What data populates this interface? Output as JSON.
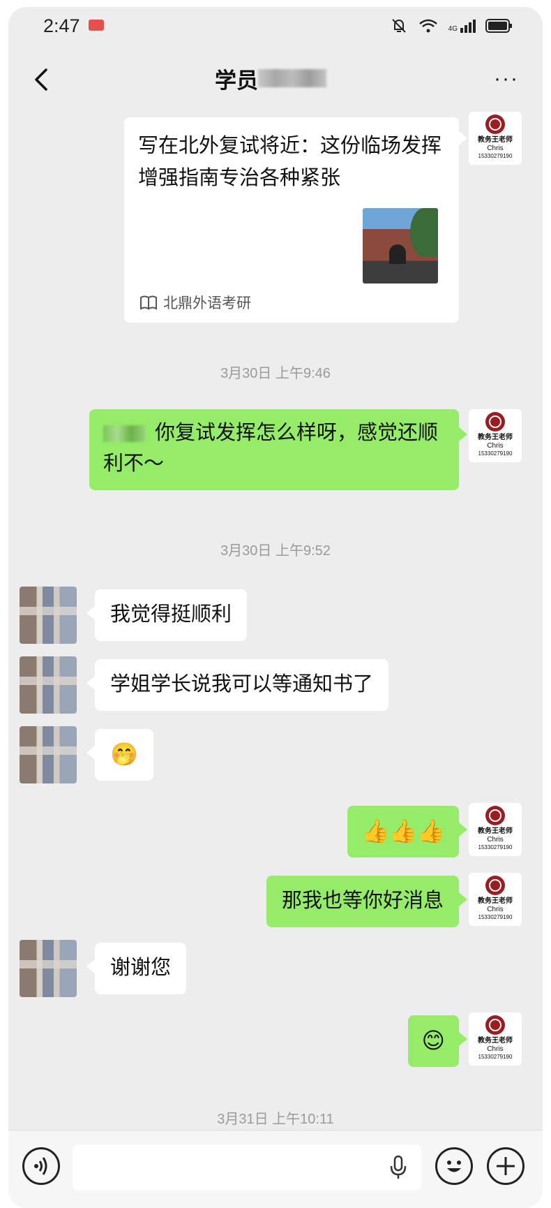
{
  "status_bar": {
    "time": "2:47",
    "icons": [
      "mute-bell-icon",
      "wifi-icon",
      "signal-icon",
      "battery-icon"
    ],
    "network": "4G"
  },
  "header": {
    "title": "学员",
    "more": "···"
  },
  "teacher_avatar": {
    "line1": "教务王老师",
    "line2": "Chris",
    "line3": "15330279190"
  },
  "article_card": {
    "title": "写在北外复试将近：这份临场发挥增强指南专治各种紧张",
    "source": "北鼎外语考研"
  },
  "messages": {
    "ts1": "3月30日 上午9:46",
    "m1": "你复试发挥怎么样呀，感觉还顺利不～",
    "ts2": "3月30日 上午9:52",
    "m2": "我觉得挺顺利",
    "m3": "学姐学长说我可以等通知书了",
    "m4": "🤭",
    "m5": "👍👍👍",
    "m6": "那我也等你好消息",
    "m7": "谢谢您",
    "m8": "😊",
    "ts3": "3月31日 上午10:11"
  },
  "colors": {
    "chat_bg": "#ededed",
    "green_bubble": "#95ec69",
    "white_bubble": "#ffffff",
    "brand_red": "#9b1d22"
  }
}
